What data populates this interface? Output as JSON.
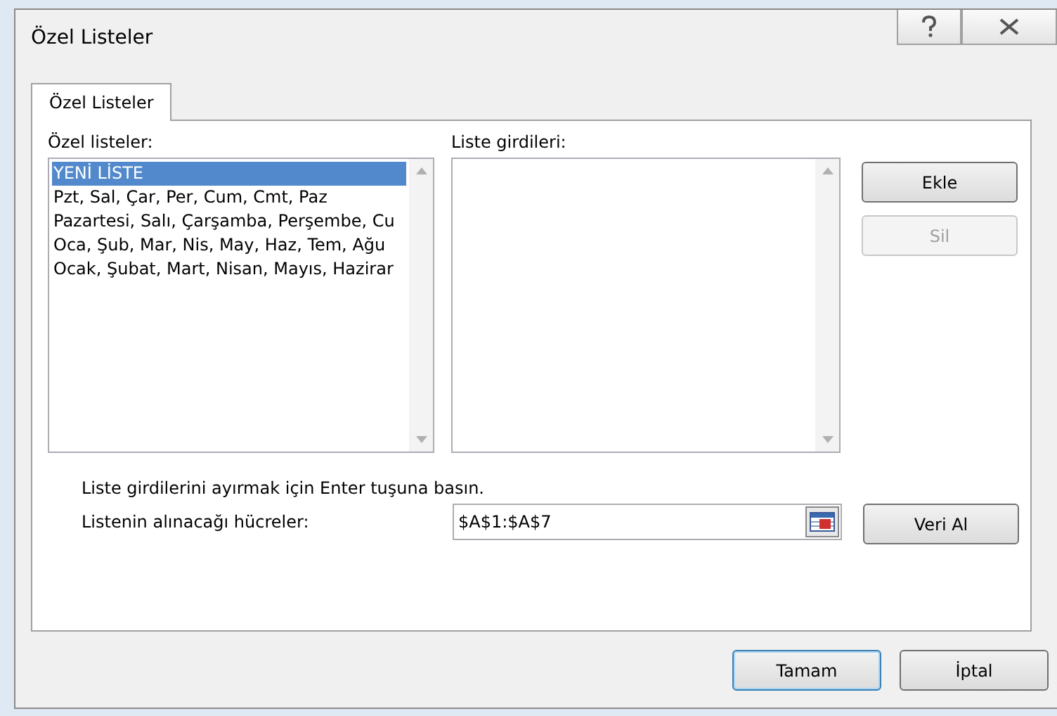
{
  "window": {
    "title": "Özel Listeler"
  },
  "tabs": [
    {
      "label": "Özel Listeler",
      "selected": true
    }
  ],
  "custom_lists": {
    "label": "Özel listeler:",
    "items": [
      {
        "text": "YENİ LİSTE",
        "selected": true
      },
      {
        "text": "Pzt, Sal, Çar, Per, Cum, Cmt, Paz",
        "selected": false
      },
      {
        "text": "Pazartesi, Salı, Çarşamba, Perşembe, Cu",
        "selected": false
      },
      {
        "text": "Oca, Şub, Mar, Nis, May, Haz, Tem, Ağu",
        "selected": false
      },
      {
        "text": "Ocak, Şubat, Mart, Nisan, Mayıs, Hazirar",
        "selected": false
      }
    ]
  },
  "list_entries": {
    "label": "Liste girdileri:"
  },
  "side_buttons": [
    {
      "label": "Ekle",
      "disabled": false
    },
    {
      "label": "Sil",
      "disabled": true
    }
  ],
  "hint": "Liste girdilerini ayırmak için Enter tuşuna basın.",
  "import": {
    "label": "Listenin alınacağı hücreler:",
    "value": "$A$1:$A$7",
    "button": "Veri Al"
  },
  "buttons": [
    {
      "label": "Tamam",
      "default": true
    },
    {
      "label": "İptal",
      "default": false
    }
  ]
}
